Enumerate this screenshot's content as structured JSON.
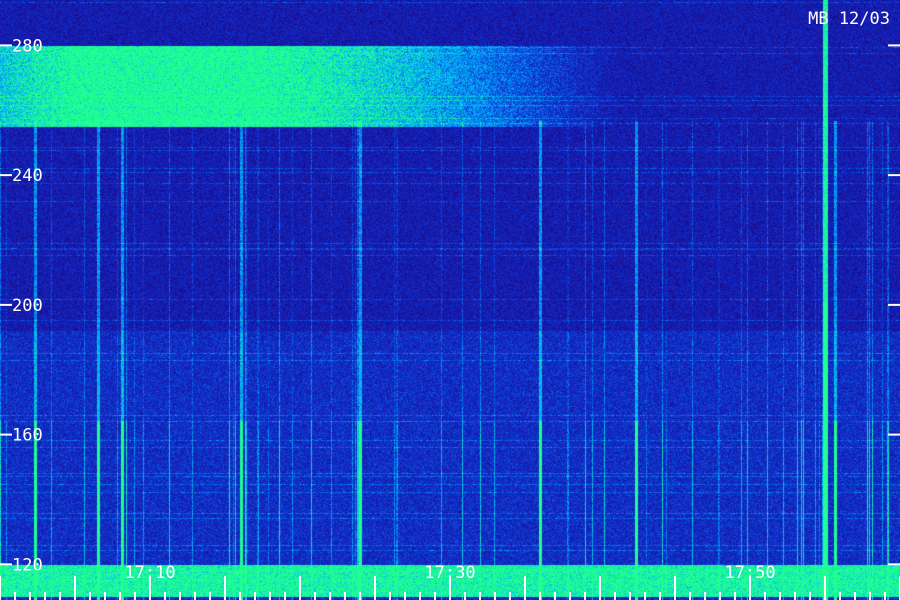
{
  "chart_data": {
    "type": "heatmap",
    "title": "MB 12/03",
    "xlabel": "",
    "ylabel": "",
    "x_ticks": [
      "17:10",
      "17:30",
      "17:50"
    ],
    "y_ticks": [
      280,
      240,
      200,
      160,
      120
    ],
    "ylim": [
      109,
      294
    ],
    "colormap": [
      "#0a0230",
      "#1a0a8a",
      "#1030d0",
      "#00b0ff",
      "#20ff90"
    ],
    "features": [
      {
        "kind": "band",
        "y_range": [
          255,
          280
        ],
        "x_range": [
          "17:05",
          "17:18"
        ],
        "intensity": 0.9
      },
      {
        "kind": "band",
        "y_range": [
          110,
          120
        ],
        "x_range": [
          "17:00",
          "18:00"
        ],
        "intensity": 0.7
      },
      {
        "kind": "line",
        "x": "17:55",
        "intensity": 1.0
      }
    ]
  }
}
